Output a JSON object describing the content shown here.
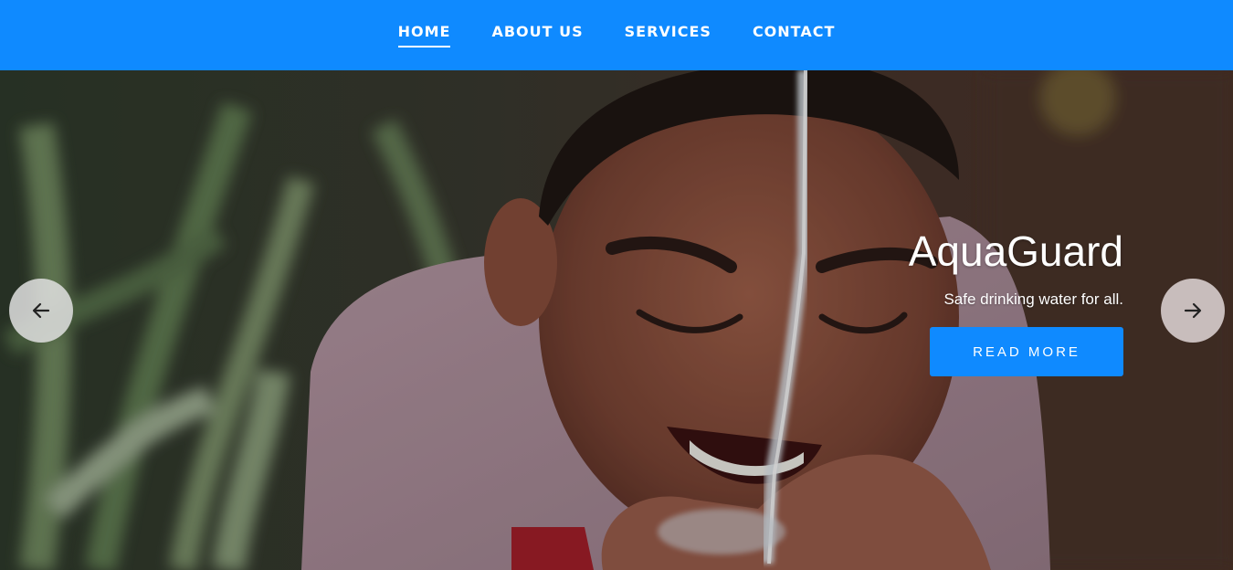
{
  "nav": {
    "items": [
      {
        "label": "HOME",
        "active": true
      },
      {
        "label": "ABOUT US",
        "active": false
      },
      {
        "label": "SERVICES",
        "active": false
      },
      {
        "label": "CONTACT",
        "active": false
      }
    ]
  },
  "hero": {
    "title": "AquaGuard",
    "subtitle": "Safe drinking water for all.",
    "cta_label": "READ MORE",
    "prev_icon": "arrow-left-icon",
    "next_icon": "arrow-right-icon"
  },
  "colors": {
    "brand_blue": "#0f8aff",
    "text_white": "#ffffff"
  }
}
